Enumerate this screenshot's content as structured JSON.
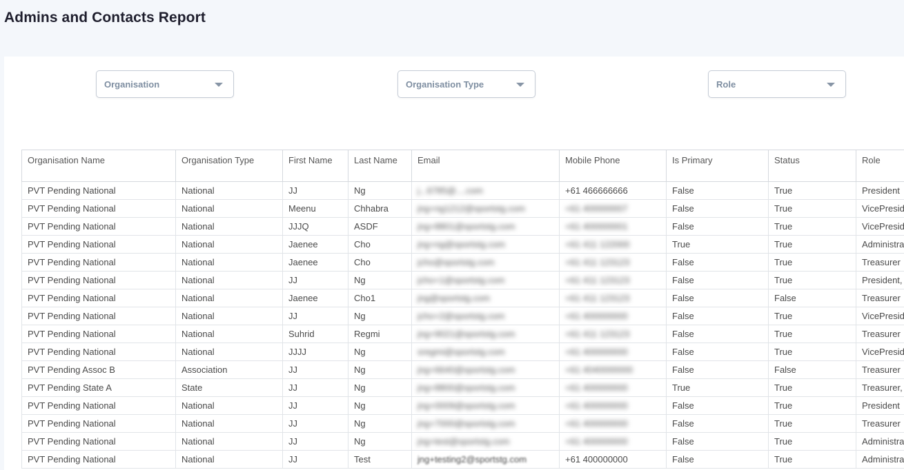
{
  "page": {
    "title": "Admins and Contacts Report"
  },
  "filters": [
    {
      "id": "organisation",
      "label": "Organisation"
    },
    {
      "id": "organisation_type",
      "label": "Organisation Type"
    },
    {
      "id": "role",
      "label": "Role"
    }
  ],
  "table": {
    "columns": [
      "Organisation Name",
      "Organisation Type",
      "First Name",
      "Last Name",
      "Email",
      "Mobile Phone",
      "Is Primary",
      "Status",
      "Role"
    ],
    "rows": [
      [
        "PVT Pending National",
        "National",
        "JJ",
        "Ng",
        "j...6785@....com",
        "+61 466666666",
        "False",
        "True",
        "President"
      ],
      [
        "PVT Pending National",
        "National",
        "Meenu",
        "Chhabra",
        "",
        "",
        "False",
        "True",
        "VicePresid"
      ],
      [
        "PVT Pending National",
        "National",
        "JJJQ",
        "ASDF",
        "",
        "",
        "False",
        "True",
        "VicePresid"
      ],
      [
        "PVT Pending National",
        "National",
        "Jaenee",
        "Cho",
        "",
        "",
        "True",
        "True",
        "Administra"
      ],
      [
        "PVT Pending National",
        "National",
        "Jaenee",
        "Cho",
        "",
        "",
        "False",
        "True",
        "Treasurer"
      ],
      [
        "PVT Pending National",
        "National",
        "JJ",
        "Ng",
        "",
        "",
        "False",
        "True",
        "President,"
      ],
      [
        "PVT Pending National",
        "National",
        "Jaenee",
        "Cho1",
        "",
        "",
        "False",
        "False",
        "Treasurer"
      ],
      [
        "PVT Pending National",
        "National",
        "JJ",
        "Ng",
        "",
        "",
        "False",
        "True",
        "VicePresid"
      ],
      [
        "PVT Pending National",
        "National",
        "Suhrid",
        "Regmi",
        "",
        "",
        "False",
        "True",
        "Treasurer"
      ],
      [
        "PVT Pending National",
        "National",
        "JJJJ",
        "Ng",
        "",
        "",
        "False",
        "True",
        "VicePresid"
      ],
      [
        "PVT Pending Assoc B",
        "Association",
        "JJ",
        "Ng",
        "",
        "",
        "False",
        "False",
        "Treasurer"
      ],
      [
        "PVT Pending State A",
        "State",
        "JJ",
        "Ng",
        "",
        "",
        "True",
        "True",
        "Treasurer,"
      ],
      [
        "PVT Pending National",
        "National",
        "JJ",
        "Ng",
        "",
        "",
        "False",
        "True",
        "President"
      ],
      [
        "PVT Pending National",
        "National",
        "JJ",
        "Ng",
        "",
        "",
        "False",
        "True",
        "Treasurer"
      ],
      [
        "PVT Pending National",
        "National",
        "JJ",
        "Ng",
        "",
        "",
        "False",
        "True",
        "Administra"
      ],
      [
        "PVT Pending National",
        "National",
        "JJ",
        "Test",
        "jng+testing2@sportstg.com",
        "+61 400000000",
        "False",
        "True",
        "Administra"
      ]
    ],
    "blurred_placeholder": {
      "email": [
        "jng+ng1212@sportstg.com",
        "jng+8801@sportstg.com",
        "jng+ng@sportstg.com",
        "jcho@sportstg.com",
        "jcho+1@sportstg.com",
        "jng@sportstg.com",
        "jcho+2@sportstg.com",
        "jng+9021@sportstg.com",
        "sregmi@sportstg.com",
        "jng+6640@sportstg.com",
        "jng+8800@sportstg.com",
        "jng+0009@sportstg.com",
        "jng+7000@sportstg.com",
        "jng+test@sportstg.com"
      ],
      "phone": [
        "+61 400000007",
        "+61 400000001",
        "+61 411 122000",
        "+61 411 123123",
        "+61 411 123123",
        "+61 411 123123",
        "+61 400000000",
        "+61 411 123123",
        "+61 400000000",
        "+61 4040000000",
        "+61 400000000",
        "+61 400000000",
        "+61 400000000",
        "+61 400000000"
      ]
    }
  }
}
